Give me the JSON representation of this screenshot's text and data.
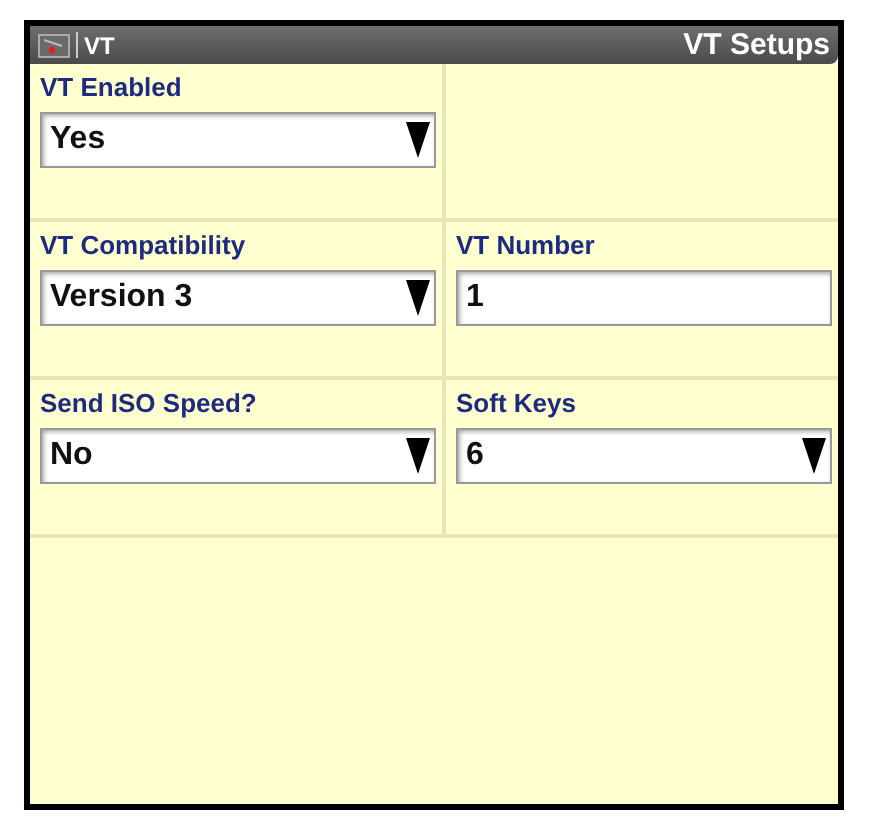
{
  "title_bar": {
    "app": "VT",
    "title": "VT Setups"
  },
  "rows": [
    {
      "cells": [
        {
          "label": "VT Enabled",
          "value": "Yes",
          "kind": "dropdown"
        }
      ]
    },
    {
      "cells": [
        {
          "label": "VT Compatibility",
          "value": "Version 3",
          "kind": "dropdown"
        },
        {
          "label": "VT Number",
          "value": "1",
          "kind": "text"
        }
      ]
    },
    {
      "cells": [
        {
          "label": "Send ISO Speed?",
          "value": "No",
          "kind": "dropdown"
        },
        {
          "label": "Soft Keys",
          "value": "6",
          "kind": "dropdown"
        }
      ]
    }
  ]
}
